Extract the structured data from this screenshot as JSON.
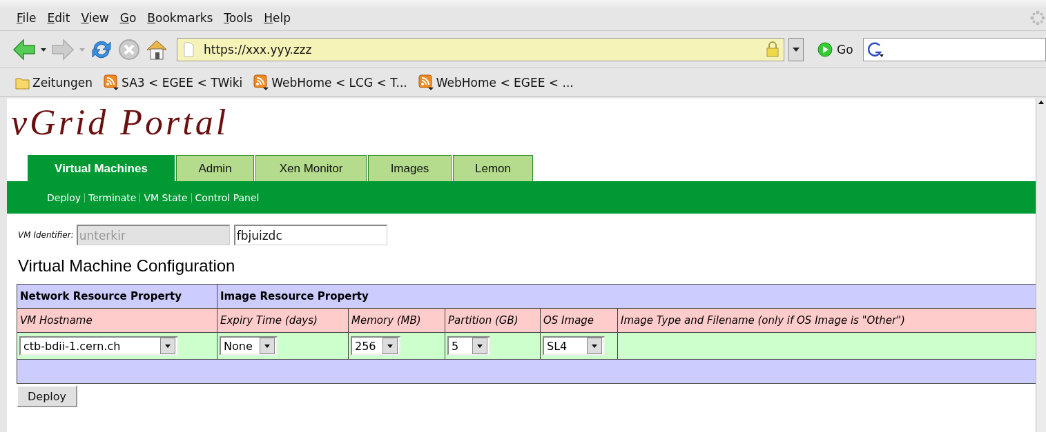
{
  "browser": {
    "menu": [
      "File",
      "Edit",
      "View",
      "Go",
      "Bookmarks",
      "Tools",
      "Help"
    ],
    "address": "https://xxx.yyy.zzz",
    "go_label": "Go",
    "bookmarks": [
      {
        "label": "Zeitungen",
        "kind": "folder"
      },
      {
        "label": "SA3 < EGEE < TWiki",
        "kind": "feed"
      },
      {
        "label": "WebHome < LCG < T...",
        "kind": "feed"
      },
      {
        "label": "WebHome < EGEE < ...",
        "kind": "feed"
      }
    ]
  },
  "portal": {
    "logo": "vGrid Portal",
    "tabs": [
      {
        "label": "Virtual Machines",
        "selected": true
      },
      {
        "label": "Admin",
        "selected": false
      },
      {
        "label": "Xen Monitor",
        "selected": false
      },
      {
        "label": "Images",
        "selected": false
      },
      {
        "label": "Lemon",
        "selected": false
      }
    ],
    "subnav": [
      "Deploy",
      "Terminate",
      "VM State",
      "Control Panel"
    ],
    "vm_identifier": {
      "label": "VM Identifier:",
      "fields": [
        {
          "value": "unterkir",
          "disabled": true
        },
        {
          "value": "fbjuizdc",
          "disabled": false
        }
      ]
    },
    "heading": "Virtual Machine Configuration",
    "table": {
      "groups": [
        {
          "label": "Network Resource Property"
        },
        {
          "label": "Image Resource Property"
        }
      ],
      "columns": [
        "VM Hostname",
        "Expiry Time (days)",
        "Memory (MB)",
        "Partition (GB)",
        "OS Image",
        "Image Type and Filename (only if OS Image is \"Other\")"
      ],
      "row": [
        {
          "kind": "select",
          "value": "ctb-bdii-1.cern.ch"
        },
        {
          "kind": "select",
          "value": "None"
        },
        {
          "kind": "select",
          "value": "256"
        },
        {
          "kind": "select",
          "value": "5"
        },
        {
          "kind": "select",
          "value": "SL4"
        },
        {
          "kind": "empty"
        }
      ]
    },
    "deploy_button": "Deploy"
  }
}
